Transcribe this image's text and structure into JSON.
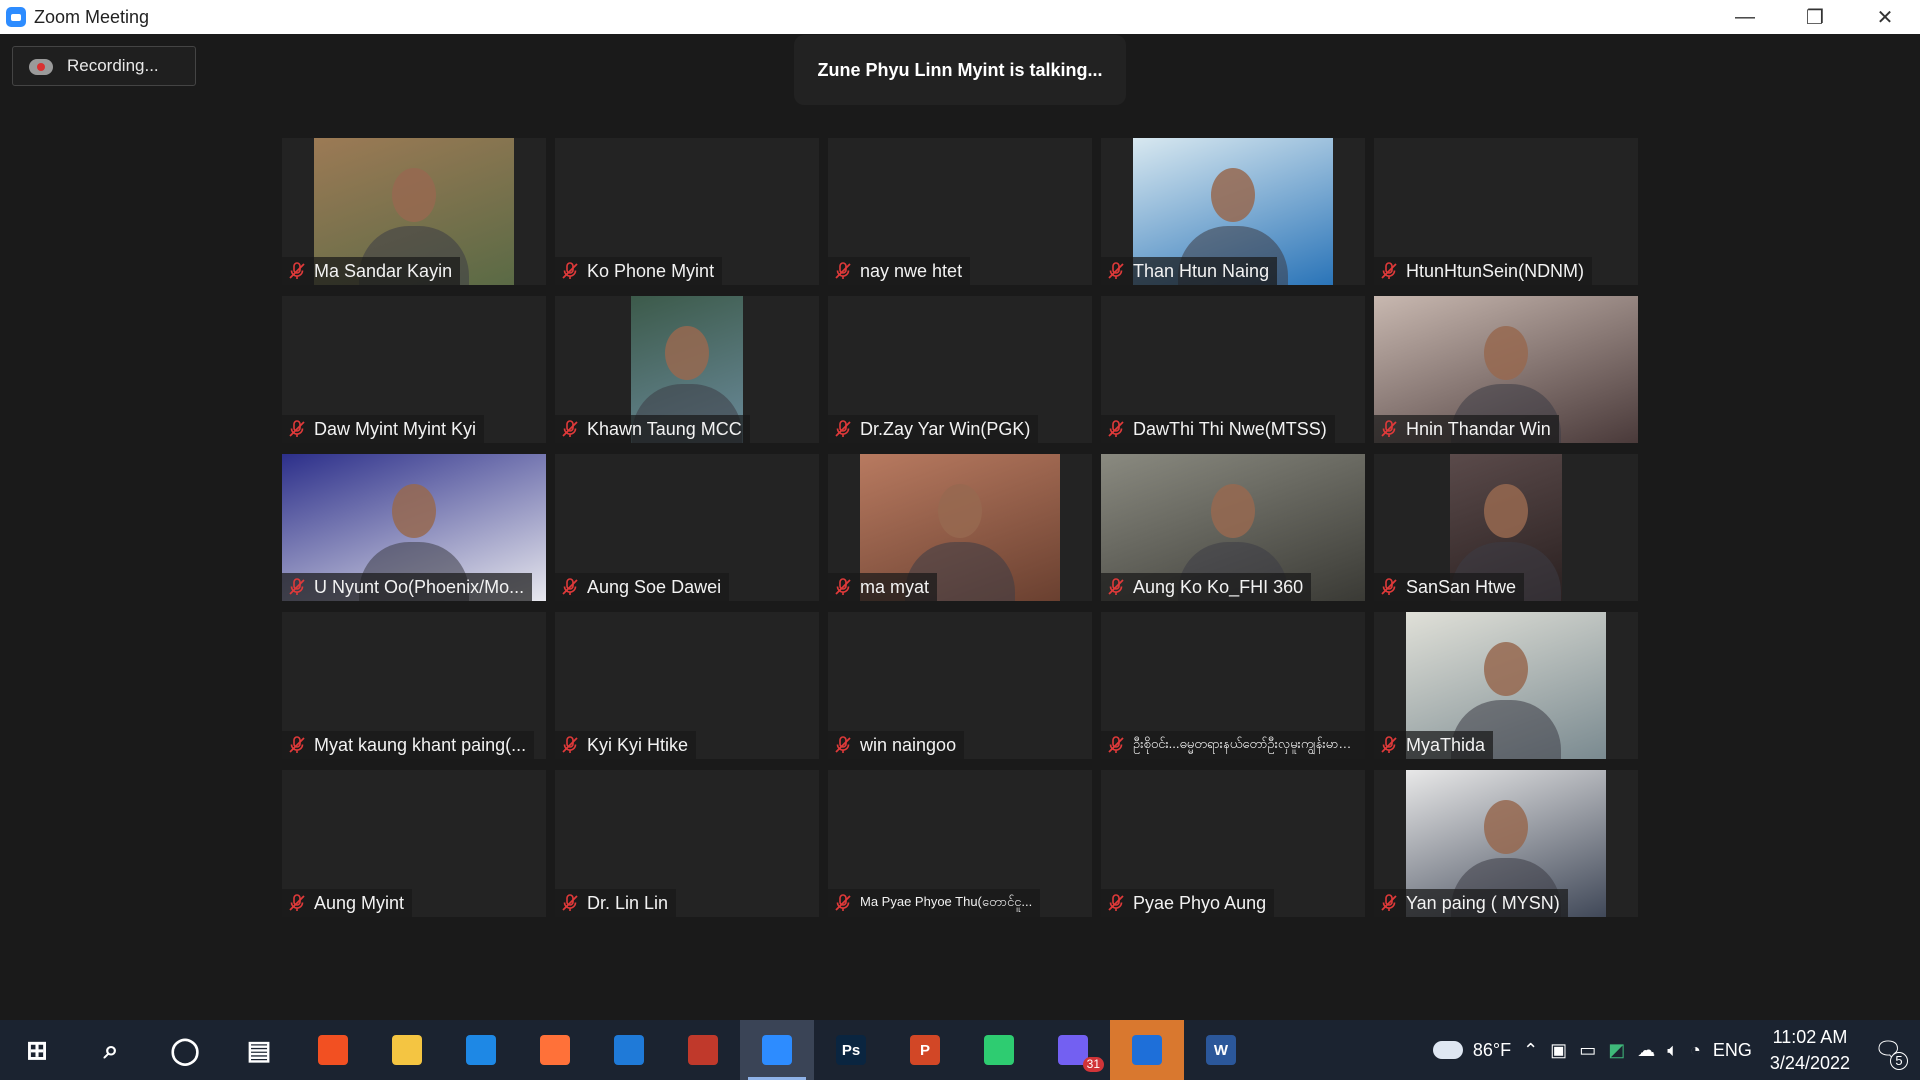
{
  "window": {
    "title": "Zoom Meeting",
    "controls": {
      "minimize": "—",
      "restore": "❐",
      "close": "✕"
    }
  },
  "meeting": {
    "recording_label": "Recording...",
    "talking_banner": "Zune Phyu Linn Myint is talking..."
  },
  "participants": [
    {
      "name": "Ma Sandar Kayin",
      "video": true,
      "bg": [
        "#9c7a55",
        "#5a6a45"
      ]
    },
    {
      "name": "Ko Phone Myint",
      "video": false
    },
    {
      "name": "nay nwe htet",
      "video": false
    },
    {
      "name": "Than Htun Naing",
      "video": true,
      "bg": [
        "#d8e8f0",
        "#2a74b8"
      ]
    },
    {
      "name": "HtunHtunSein(NDNM)",
      "video": false
    },
    {
      "name": "Daw Myint Myint Kyi",
      "video": false
    },
    {
      "name": "Khawn Taung MCC",
      "video": true,
      "bg": [
        "#3c5a4a",
        "#6a8a9a"
      ]
    },
    {
      "name": "Dr.Zay Yar Win(PGK)",
      "video": false
    },
    {
      "name": "DawThi Thi Nwe(MTSS)",
      "video": false
    },
    {
      "name": "Hnin Thandar Win",
      "video": true,
      "bg": [
        "#c8b8b0",
        "#4a3a3a"
      ]
    },
    {
      "name": "U Nyunt Oo(Phoenix/Mo...",
      "video": true,
      "bg": [
        "#2c2f8a",
        "#e8e8ee"
      ]
    },
    {
      "name": "Aung Soe Dawei",
      "video": false
    },
    {
      "name": "ma myat",
      "video": true,
      "bg": [
        "#b87a60",
        "#6a4030"
      ]
    },
    {
      "name": "Aung Ko Ko_FHI 360",
      "video": true,
      "bg": [
        "#8a8a80",
        "#3a3a35"
      ]
    },
    {
      "name": "SanSan Htwe",
      "video": true,
      "bg": [
        "#5a4a4a",
        "#2a2020"
      ]
    },
    {
      "name": "Myat kaung khant paing(...",
      "video": false
    },
    {
      "name": "Kyi Kyi Htike",
      "video": false
    },
    {
      "name": "win naingoo",
      "video": false
    },
    {
      "name": "ဦးစိုဝင်း...ဓမ္မတရားနယ်တော်ဦးလှမူးကျွန်းမာအဖွဲ့ပြည",
      "video": false
    },
    {
      "name": "MyaThida",
      "video": true,
      "bg": [
        "#e0e0d8",
        "#7a8a90"
      ]
    },
    {
      "name": "Aung Myint",
      "video": false
    },
    {
      "name": "Dr. Lin Lin",
      "video": false
    },
    {
      "name": "Ma Pyae Phyoe Thu(တောင်ငူ...",
      "video": false
    },
    {
      "name": "Pyae Phyo Aung",
      "video": false
    },
    {
      "name": "Yan paing ( MYSN)",
      "video": true,
      "bg": [
        "#e8e8e8",
        "#404858"
      ]
    }
  ],
  "taskbar": {
    "apps": [
      {
        "icon": "windows-start-icon",
        "label": "",
        "color": "#ffffff"
      },
      {
        "icon": "search-icon",
        "label": "",
        "color": "#ffffff"
      },
      {
        "icon": "cortana-icon",
        "label": "",
        "color": "#ffffff"
      },
      {
        "icon": "task-view-icon",
        "label": "",
        "color": "#ffffff"
      },
      {
        "icon": "microsoft-store-icon",
        "label": "",
        "color": "#f25022"
      },
      {
        "icon": "file-explorer-icon",
        "label": "",
        "color": "#f4c542"
      },
      {
        "icon": "edge-icon",
        "label": "",
        "color": "#1e88e5"
      },
      {
        "icon": "firefox-icon",
        "label": "",
        "color": "#ff7139"
      },
      {
        "icon": "mail-icon",
        "label": "",
        "color": "#1f7ad8"
      },
      {
        "icon": "keyboard-language-icon",
        "label": "",
        "color": "#c0392b"
      },
      {
        "icon": "zoom-icon",
        "label": "",
        "color": "#2d8cff"
      },
      {
        "icon": "photoshop-icon",
        "label": "Ps",
        "color": "#0a2540"
      },
      {
        "icon": "powerpoint-icon",
        "label": "P",
        "color": "#d24726"
      },
      {
        "icon": "vpn-icon",
        "label": "",
        "color": "#2ecc71"
      },
      {
        "icon": "viber-icon",
        "label": "",
        "color": "#7360f2",
        "badge": "31"
      },
      {
        "icon": "browser-icon",
        "label": "",
        "color": "#1e6fd9"
      },
      {
        "icon": "word-icon",
        "label": "W",
        "color": "#2b579a"
      }
    ],
    "tray": {
      "weather": "86°F",
      "language": "ENG",
      "time": "11:02 AM",
      "date": "3/24/2022",
      "notifications": "5"
    }
  }
}
